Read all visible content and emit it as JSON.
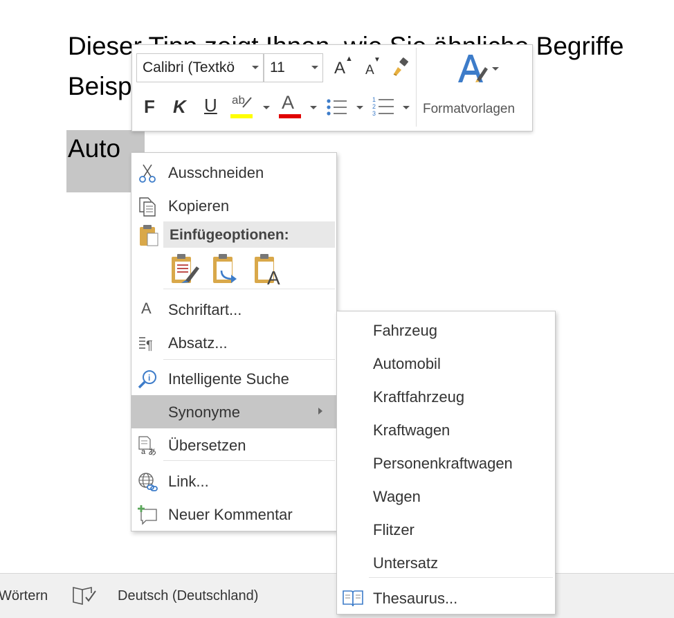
{
  "document": {
    "line1": "Dieser Tipp zeigt Ihnen, wie Sie ähnliche Begriffe",
    "line2": "Beispiel",
    "selected_word": "Auto"
  },
  "minitoolbar": {
    "font_name": "Calibri (Textkö",
    "font_size": "11",
    "grow_font": "A",
    "shrink_font": "A",
    "bold": "F",
    "italic": "K",
    "underline": "U",
    "highlight_text": "ab",
    "font_color_text": "A",
    "styles_label": "Formatvorlagen",
    "colors": {
      "highlight": "#ffff00",
      "font_color": "#e00000",
      "styles_accent": "#3d7cc9"
    }
  },
  "context_menu": {
    "cut": "Ausschneiden",
    "copy": "Kopieren",
    "paste_options": "Einfügeoptionen:",
    "font": "Schriftart...",
    "paragraph": "Absatz...",
    "smart_lookup": "Intelligente Suche",
    "synonyms": "Synonyme",
    "translate": "Übersetzen",
    "link": "Link...",
    "new_comment": "Neuer Kommentar"
  },
  "synonyms_submenu": {
    "items": [
      "Fahrzeug",
      "Automobil",
      "Kraftfahrzeug",
      "Kraftwagen",
      "Personenkraftwagen",
      "Wagen",
      "Flitzer",
      "Untersatz"
    ],
    "thesaurus": "Thesaurus..."
  },
  "statusbar": {
    "words": "Wörtern",
    "language": "Deutsch (Deutschland)"
  }
}
